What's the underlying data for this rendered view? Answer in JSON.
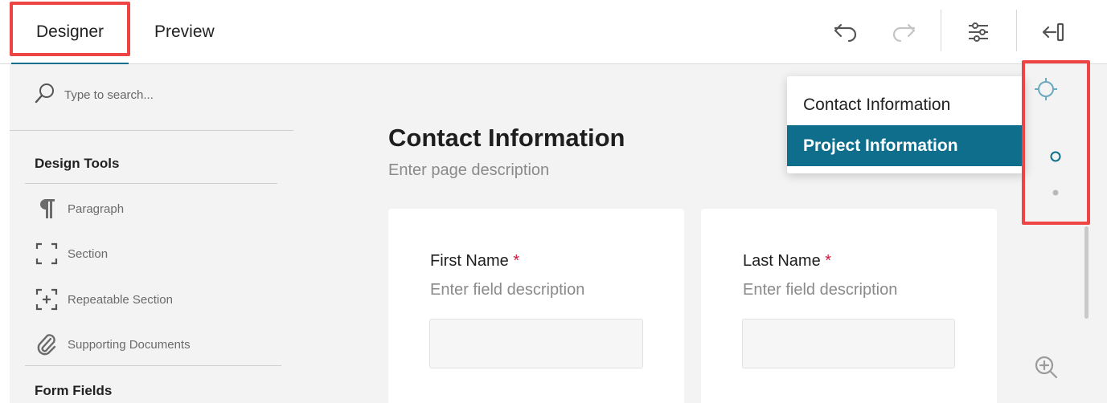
{
  "header": {
    "tabs": [
      {
        "label": "Designer",
        "active": true
      },
      {
        "label": "Preview",
        "active": false
      }
    ],
    "icons": [
      "undo-icon",
      "redo-icon",
      "settings-sliders-icon",
      "collapse-panel-icon"
    ]
  },
  "left_panel": {
    "search": {
      "placeholder": "Type to search...",
      "value": ""
    },
    "design_tools": {
      "title": "Design Tools",
      "items": [
        {
          "label": "Paragraph",
          "icon": "paragraph-icon"
        },
        {
          "label": "Section",
          "icon": "section-icon"
        },
        {
          "label": "Repeatable Section",
          "icon": "repeatable-section-icon"
        },
        {
          "label": "Supporting Documents",
          "icon": "paperclip-icon"
        }
      ]
    },
    "form_fields": {
      "title": "Form Fields"
    }
  },
  "main": {
    "page_title": "Contact Information",
    "page_description": "Enter page description",
    "fields": [
      {
        "label": "First Name",
        "required_mark": "*",
        "description": "Enter field description",
        "value": ""
      },
      {
        "label": "Last Name",
        "required_mark": "*",
        "description": "Enter field description",
        "value": ""
      }
    ]
  },
  "page_nav_dropdown": {
    "items": [
      {
        "label": "Contact Information",
        "selected": false
      },
      {
        "label": "Project Information",
        "selected": true
      }
    ]
  },
  "colors": {
    "accent": "#0f6e8c",
    "highlight": "#ef4444",
    "required": "#d1183b",
    "panel_bg": "#f3f3f3"
  }
}
